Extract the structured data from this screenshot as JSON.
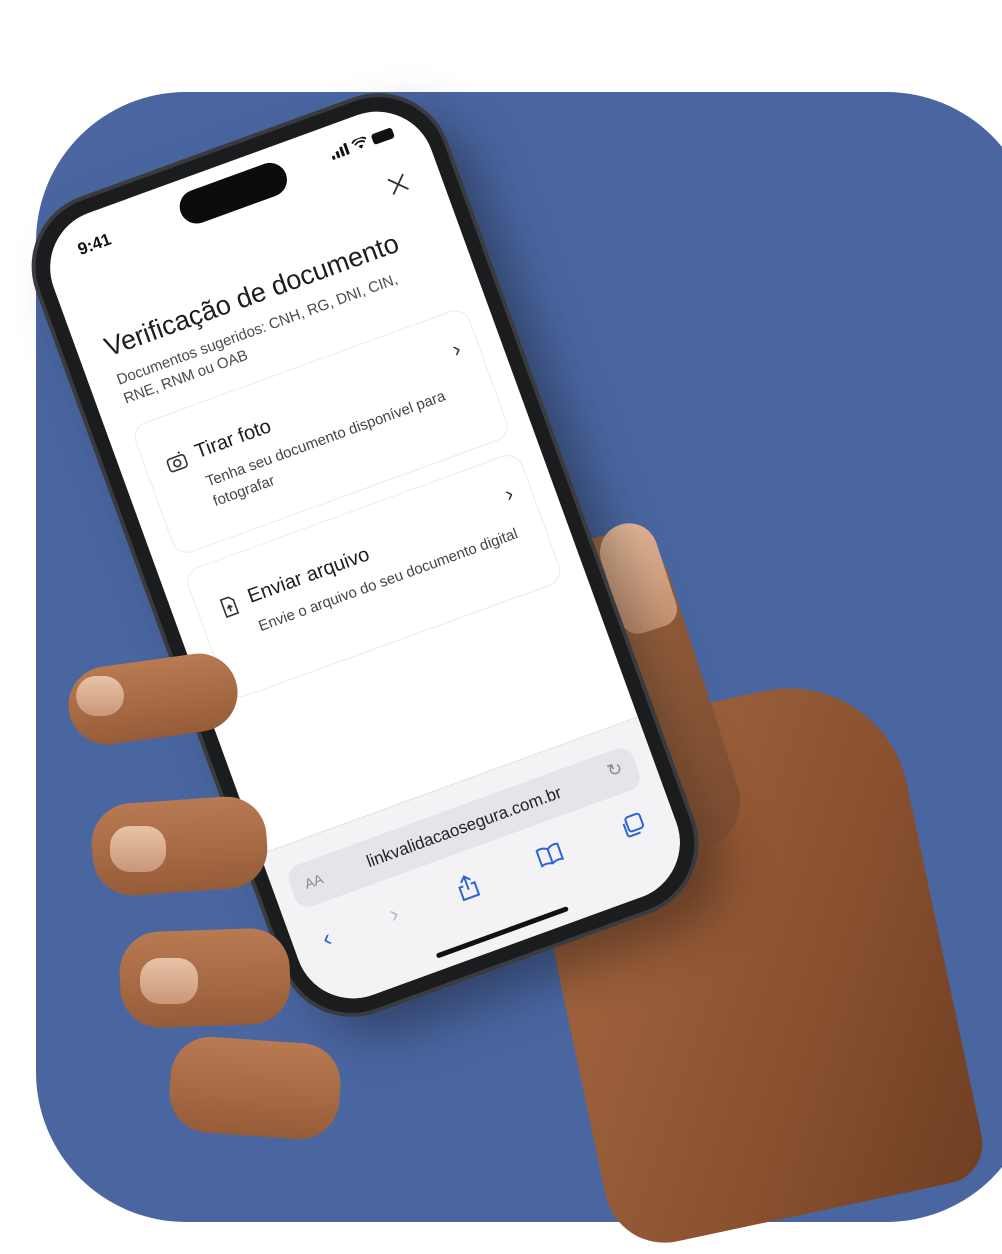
{
  "status": {
    "time": "9:41"
  },
  "page": {
    "title": "Verificação de documento",
    "subtitle": "Documentos sugeridos: CNH, RG, DNI, CIN, RNE, RNM ou OAB"
  },
  "options": [
    {
      "title": "Tirar foto",
      "description": "Tenha seu documento disponível para fotografar",
      "icon": "camera-icon"
    },
    {
      "title": "Enviar arquivo",
      "description": "Envie o arquivo do seu documento digital",
      "icon": "file-upload-icon"
    }
  ],
  "browser": {
    "aa_label": "AA",
    "url": "linkvalidacaosegura.com.br"
  },
  "colors": {
    "background_card": "#4a66a1",
    "accent": "#2f62d8"
  }
}
